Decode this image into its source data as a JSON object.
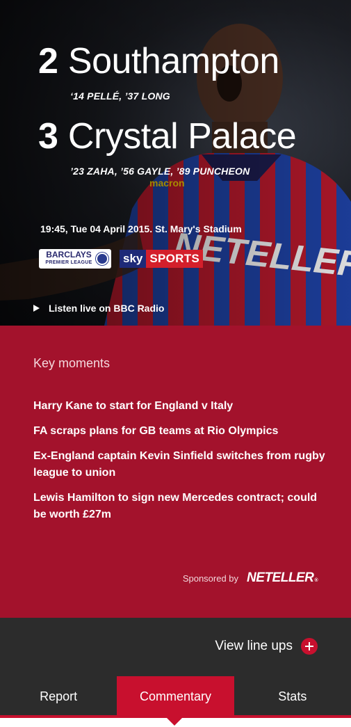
{
  "match": {
    "home": {
      "score": "2",
      "team": "Southampton",
      "scorers": "‘14 PELLÉ, ’37 LONG"
    },
    "away": {
      "score": "3",
      "team": "Crystal Palace",
      "scorers": "’23 ZAHA, ’56 GAYLE, ’89 PUNCHEON"
    },
    "info": "19:45, Tue 04 April 2015. St. Mary's Stadium",
    "broadcasters": {
      "league_logo_line1": "BARCLAYS",
      "league_logo_line2": "PREMIER LEAGUE",
      "tv_logo_part1": "sky",
      "tv_logo_part2": "SPORTS"
    },
    "listen_label": "Listen live on BBC Radio"
  },
  "key_moments": {
    "title": "Key moments",
    "items": [
      "Harry Kane to start for England v Italy",
      "FA scraps plans for GB teams at Rio Olympics",
      "Ex-England captain Kevin Sinfield switches from rugby league to union",
      "Lewis Hamilton to sign new Mercedes contract; could be worth £27m"
    ],
    "sponsor_label": "Sponsored by",
    "sponsor_brand": "NETELLER",
    "sponsor_reg": "®"
  },
  "footer": {
    "lineups_label": "View line ups",
    "tabs": [
      {
        "label": "Report",
        "active": false
      },
      {
        "label": "Commentary",
        "active": true
      },
      {
        "label": "Stats",
        "active": false
      }
    ]
  },
  "colors": {
    "accent": "#c8102e",
    "panel": "#a3122c",
    "dark": "#2c2c2c"
  },
  "icons": {
    "play": "play-icon",
    "plus": "plus-circle-icon"
  }
}
